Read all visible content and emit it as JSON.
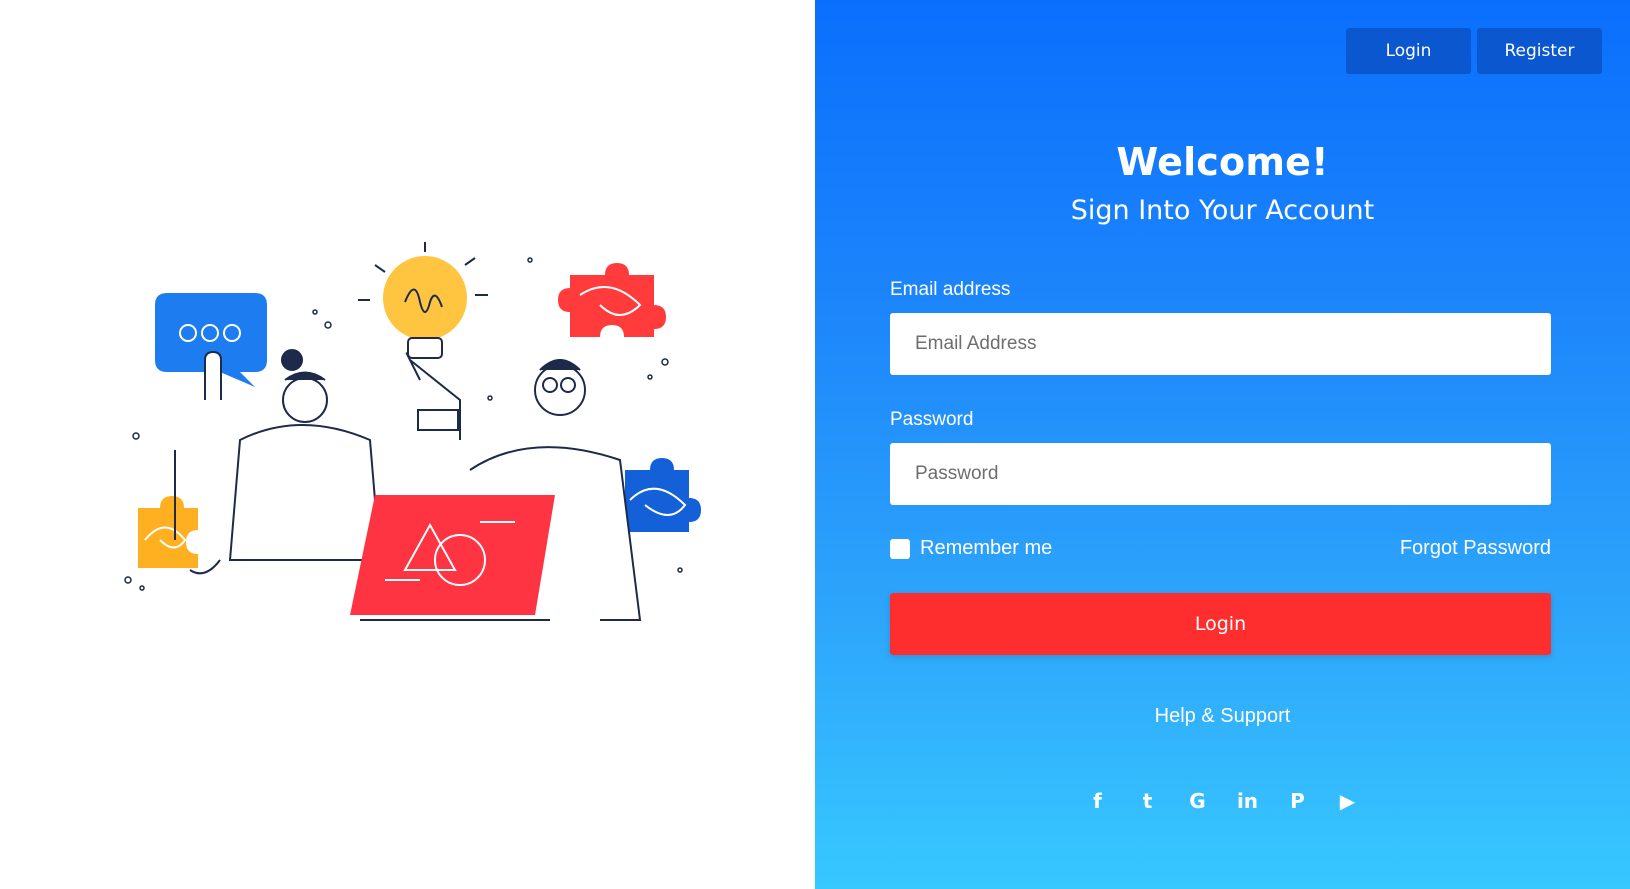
{
  "colors": {
    "primary": "#0a6ffd",
    "gradient_end": "#37c8ff",
    "button_dark": "#0b57d0",
    "accent_red": "#ff2e2e",
    "white": "#ffffff"
  },
  "topbar": {
    "login_label": "Login",
    "register_label": "Register"
  },
  "hero": {
    "title": "Welcome!",
    "subtitle": "Sign Into Your Account"
  },
  "form": {
    "email_label": "Email address",
    "email_placeholder": "Email Address",
    "email_value": "",
    "password_label": "Password",
    "password_placeholder": "Password",
    "password_value": "",
    "remember_label": "Remember me",
    "remember_checked": false,
    "forgot_label": "Forgot Password",
    "login_label": "Login"
  },
  "help": {
    "label": "Help & Support"
  },
  "social": [
    {
      "name": "facebook-icon",
      "glyph": "f"
    },
    {
      "name": "twitter-icon",
      "glyph": "t"
    },
    {
      "name": "google-icon",
      "glyph": "G"
    },
    {
      "name": "linkedin-icon",
      "glyph": "in"
    },
    {
      "name": "pinterest-icon",
      "glyph": "P"
    },
    {
      "name": "youtube-icon",
      "glyph": "▶"
    }
  ],
  "illustration": {
    "chat_bubble_color": "#1c7cf0",
    "bulb_color": "#ffc540",
    "puzzle_red": "#ff3b3b",
    "puzzle_blue": "#1360d8",
    "puzzle_yellow": "#ffb020",
    "laptop_color": "#ff3443"
  }
}
